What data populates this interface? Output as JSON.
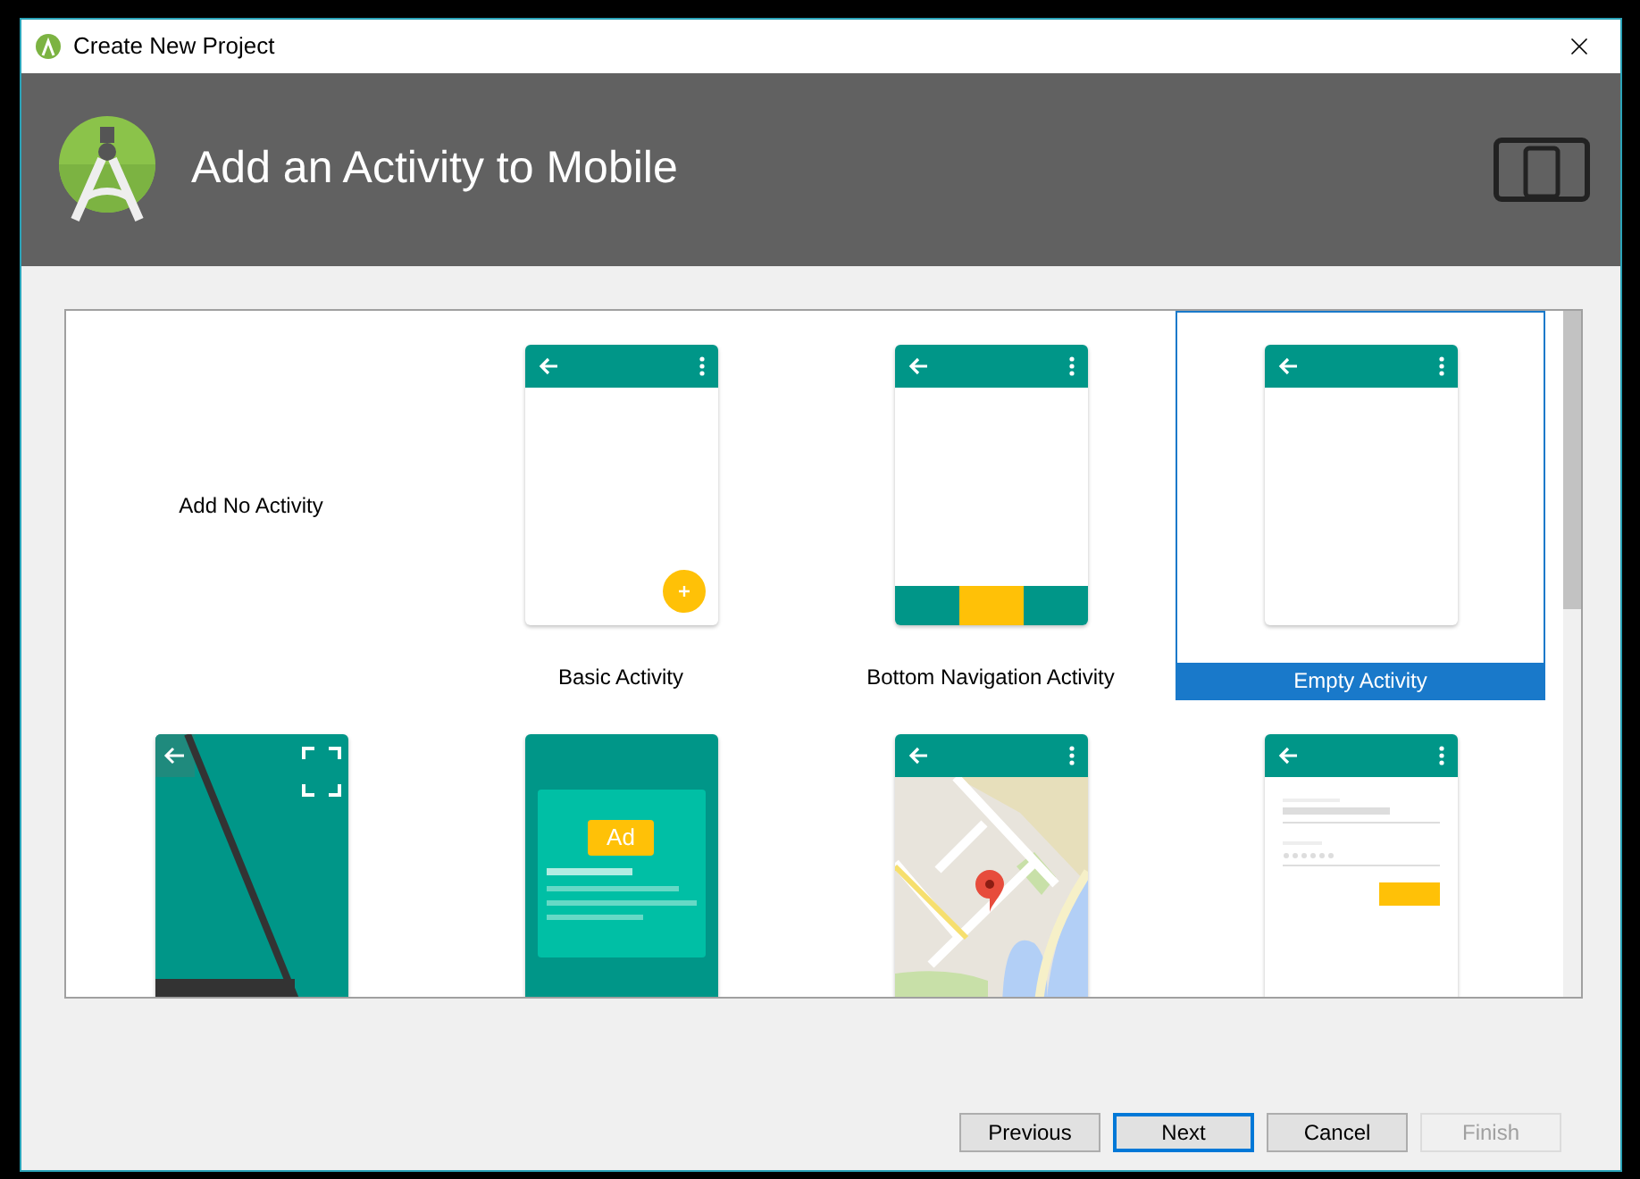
{
  "window": {
    "title": "Create New Project"
  },
  "header": {
    "title": "Add an Activity to Mobile"
  },
  "activities": [
    {
      "kind": "none",
      "label": "Add No Activity",
      "selected": false
    },
    {
      "kind": "basic",
      "label": "Basic Activity",
      "selected": false
    },
    {
      "kind": "bottom_nav",
      "label": "Bottom Navigation Activity",
      "selected": false
    },
    {
      "kind": "empty",
      "label": "Empty Activity",
      "selected": true
    },
    {
      "kind": "fullscreen",
      "selected": false
    },
    {
      "kind": "ad",
      "ad_text": "Ad",
      "selected": false
    },
    {
      "kind": "map",
      "selected": false
    },
    {
      "kind": "login",
      "selected": false
    }
  ],
  "buttons": [
    {
      "label": "Previous",
      "default": false,
      "disabled": false
    },
    {
      "label": "Next",
      "default": true,
      "disabled": false
    },
    {
      "label": "Cancel",
      "default": false,
      "disabled": false
    },
    {
      "label": "Finish",
      "default": false,
      "disabled": true
    }
  ]
}
